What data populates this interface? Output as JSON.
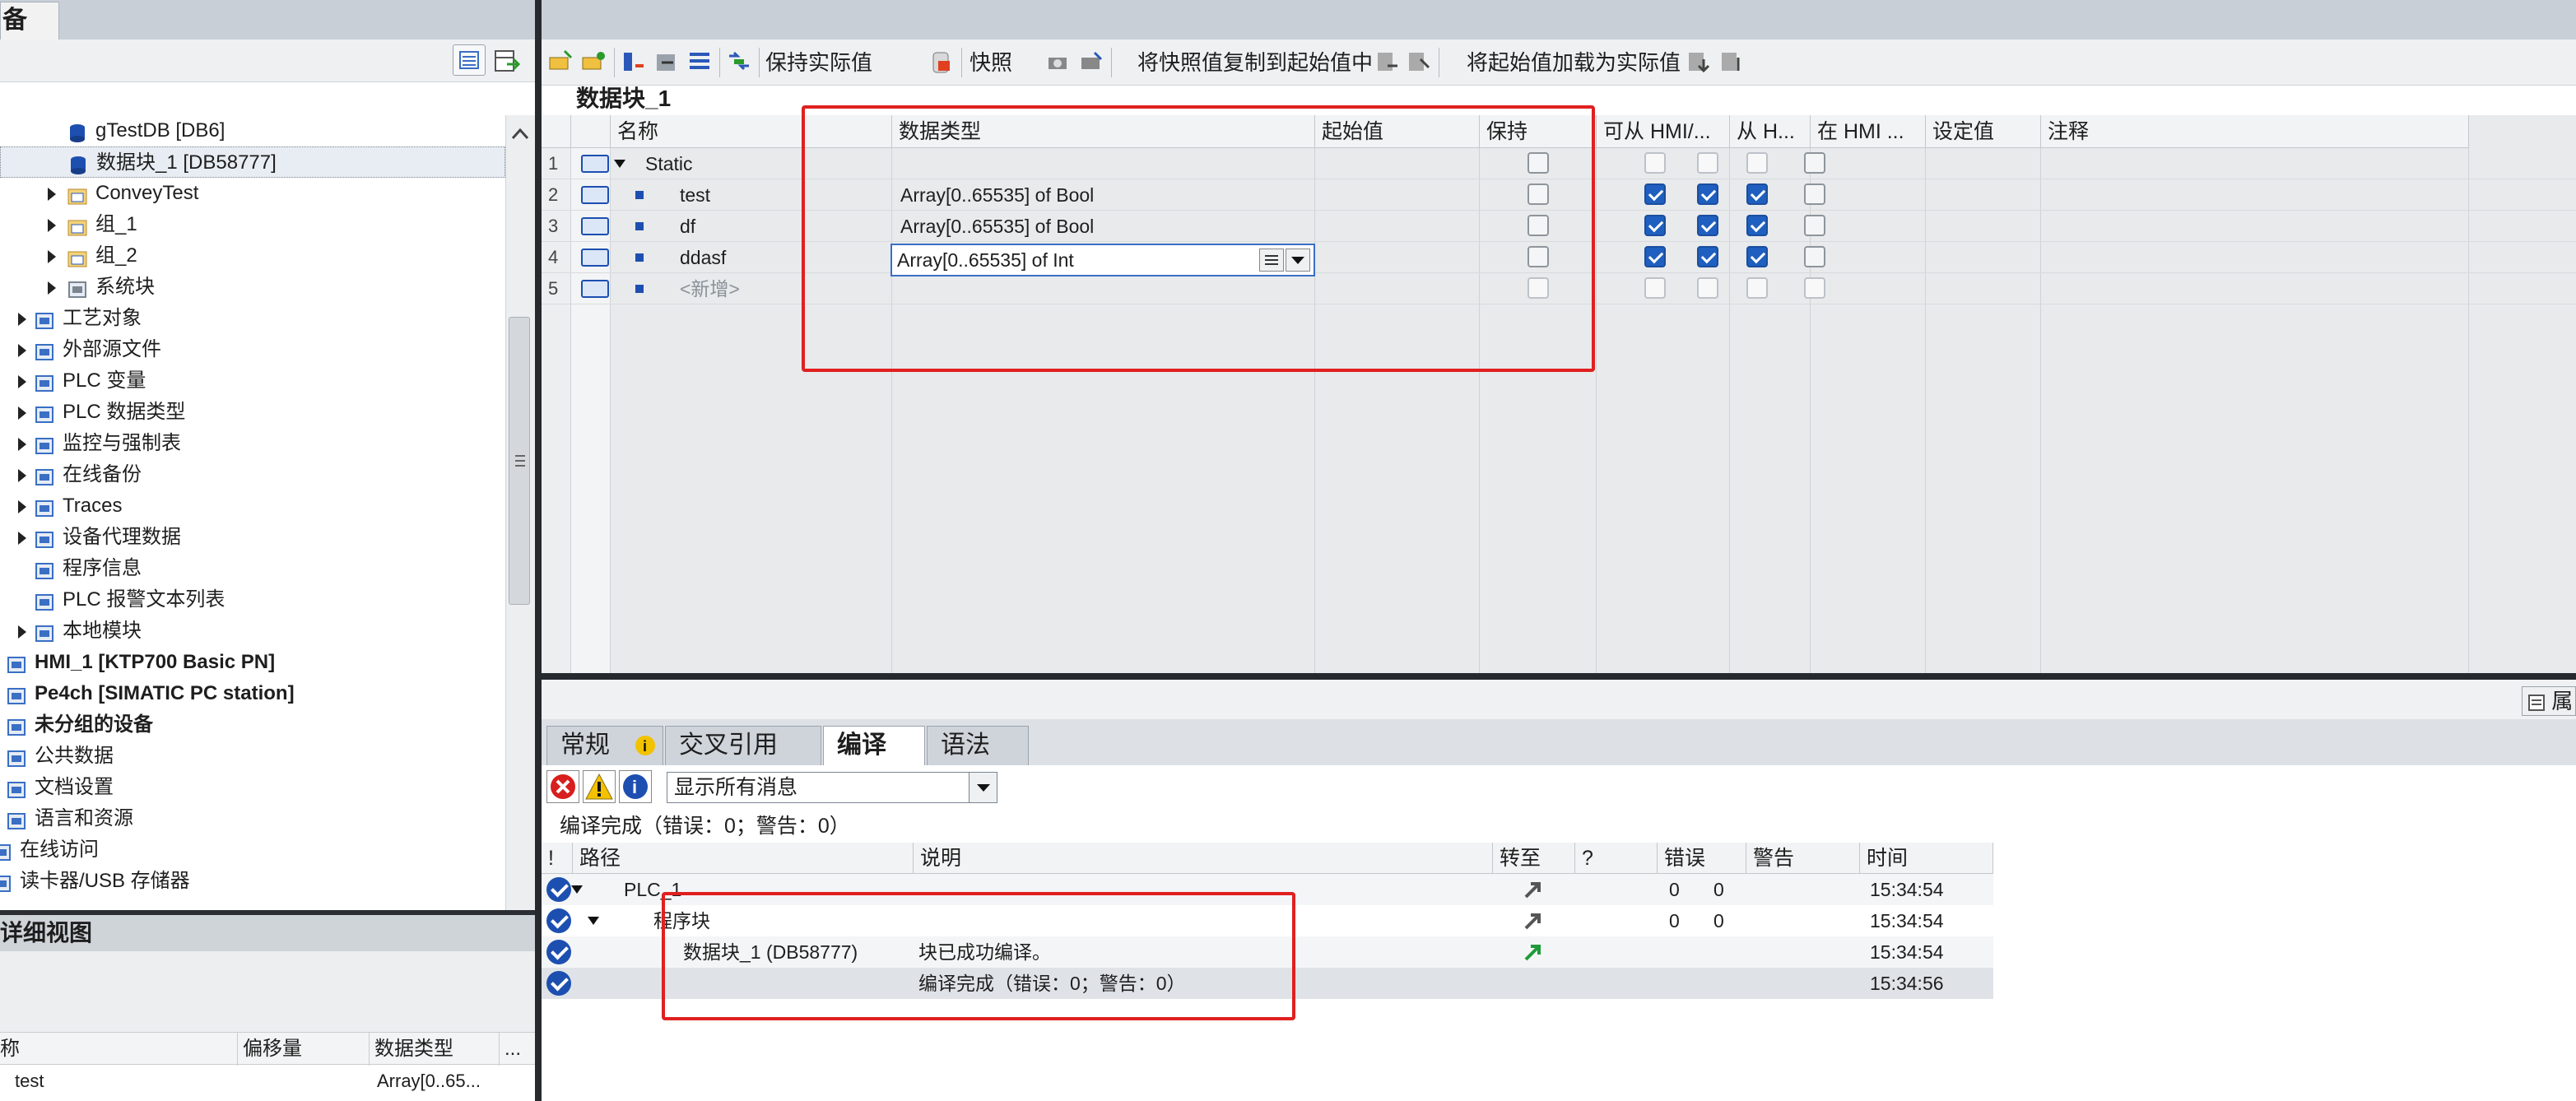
{
  "left_panel": {
    "tab_label": "备",
    "tree": [
      {
        "label": "gTestDB [DB6]",
        "icon": "db-icon",
        "indent": 2
      },
      {
        "label": "数据块_1 [DB58777]",
        "icon": "db-icon",
        "indent": 2,
        "selected": true
      },
      {
        "label": "ConveyTest",
        "icon": "folder-icon",
        "indent": 2,
        "expand": true
      },
      {
        "label": "组_1",
        "icon": "folder-icon",
        "indent": 2,
        "expand": true
      },
      {
        "label": "组_2",
        "icon": "folder-icon",
        "indent": 2,
        "expand": true
      },
      {
        "label": "系统块",
        "icon": "system-block-icon",
        "indent": 2,
        "expand": true
      },
      {
        "label": "工艺对象",
        "icon": "technology-object-icon",
        "indent": 1,
        "expand": true
      },
      {
        "label": "外部源文件",
        "icon": "external-source-icon",
        "indent": 1,
        "expand": true
      },
      {
        "label": "PLC 变量",
        "icon": "plc-tag-icon",
        "indent": 1,
        "expand": true
      },
      {
        "label": "PLC 数据类型",
        "icon": "plc-datatype-icon",
        "indent": 1,
        "expand": true
      },
      {
        "label": "监控与强制表",
        "icon": "watch-table-icon",
        "indent": 1,
        "expand": true
      },
      {
        "label": "在线备份",
        "icon": "online-backup-icon",
        "indent": 1,
        "expand": true
      },
      {
        "label": "Traces",
        "icon": "traces-icon",
        "indent": 1,
        "expand": true
      },
      {
        "label": "设备代理数据",
        "icon": "device-proxy-icon",
        "indent": 1,
        "expand": true
      },
      {
        "label": "程序信息",
        "icon": "program-info-icon",
        "indent": 1
      },
      {
        "label": "PLC 报警文本列表",
        "icon": "alarm-text-icon",
        "indent": 1
      },
      {
        "label": "本地模块",
        "icon": "local-module-icon",
        "indent": 1,
        "expand": true
      },
      {
        "label": "HMI_1 [KTP700 Basic PN]",
        "icon": "hmi-icon",
        "indent": 0,
        "bold": true
      },
      {
        "label": "Pe4ch [SIMATIC PC station]",
        "icon": "pc-station-icon",
        "indent": 0,
        "bold": true
      },
      {
        "label": "未分组的设备",
        "icon": "ungrouped-devices-icon",
        "indent": 0,
        "bold": true
      },
      {
        "label": "公共数据",
        "icon": "common-data-icon",
        "indent": 0
      },
      {
        "label": "文档设置",
        "icon": "document-settings-icon",
        "indent": 0
      },
      {
        "label": "语言和资源",
        "icon": "languages-icon",
        "indent": 0
      },
      {
        "label": "在线访问",
        "icon": "online-access-icon",
        "indent": -1
      },
      {
        "label": "读卡器/USB 存储器",
        "icon": "card-reader-icon",
        "indent": -1
      }
    ],
    "detail_view": {
      "title": "详细视图",
      "headers": [
        "称",
        "偏移量",
        "数据类型",
        "..."
      ],
      "row": {
        "name": "test",
        "type": "Array[0..65..."
      }
    }
  },
  "toolbar": {
    "keep_actual": "保持实际值",
    "snapshot": "快照",
    "copy_snapshot": "将快照值复制到起始值中",
    "load_start": "将起始值加载为实际值"
  },
  "db_editor": {
    "title": "数据块_1",
    "headers": [
      "名称",
      "数据类型",
      "起始值",
      "保持",
      "可从 HMI/...",
      "从 H...",
      "在 HMI ...",
      "设定值",
      "注释"
    ],
    "rows": [
      {
        "num": "1",
        "name": "Static",
        "type": "",
        "expand": true,
        "retain": false,
        "hmi1": false,
        "hmi2": false,
        "hmi3": false,
        "setpoint": false,
        "dim_hmi": false
      },
      {
        "num": "2",
        "name": "test",
        "type": "Array[0..65535] of Bool",
        "retain": false,
        "hmi1": true,
        "hmi2": true,
        "hmi3": true,
        "setpoint": false
      },
      {
        "num": "3",
        "name": "df",
        "type": "Array[0..65535] of Bool",
        "retain": false,
        "hmi1": true,
        "hmi2": true,
        "hmi3": true,
        "setpoint": false
      },
      {
        "num": "4",
        "name": "ddasf",
        "type": "Array[0..65535] of Int",
        "retain": false,
        "hmi1": true,
        "hmi2": true,
        "hmi3": true,
        "setpoint": false,
        "editing": true
      },
      {
        "num": "5",
        "name": "<新增>",
        "type": "",
        "placeholder": true
      }
    ]
  },
  "inspector": {
    "properties_btn": "属",
    "tabs": [
      "常规",
      "交叉引用",
      "编译",
      "语法"
    ],
    "active_tab": "编译",
    "filter": "显示所有消息",
    "summary": "编译完成（错误：0；警告：0）",
    "headers": [
      "!",
      "路径",
      "说明",
      "转至",
      "?",
      "错误",
      "警告",
      "时间"
    ],
    "rows": [
      {
        "path": "PLC_1",
        "desc": "",
        "errors": "0",
        "warnings": "0",
        "time": "15:34:54",
        "goto": "gray",
        "level": 0,
        "expand": true
      },
      {
        "path": "程序块",
        "desc": "",
        "errors": "0",
        "warnings": "0",
        "time": "15:34:54",
        "goto": "gray",
        "level": 1,
        "expand": true
      },
      {
        "path": "数据块_1 (DB58777)",
        "desc": "块已成功编译。",
        "errors": "",
        "warnings": "",
        "time": "15:34:54",
        "goto": "green",
        "level": 2
      },
      {
        "path": "",
        "desc": "编译完成（错误：0；警告：0）",
        "errors": "",
        "warnings": "",
        "time": "15:34:56",
        "goto": "",
        "level": 2,
        "highlight": true
      }
    ]
  },
  "colors": {
    "accent": "#1d4fb0",
    "annotation": "#e02020",
    "divider": "#262a2e"
  }
}
